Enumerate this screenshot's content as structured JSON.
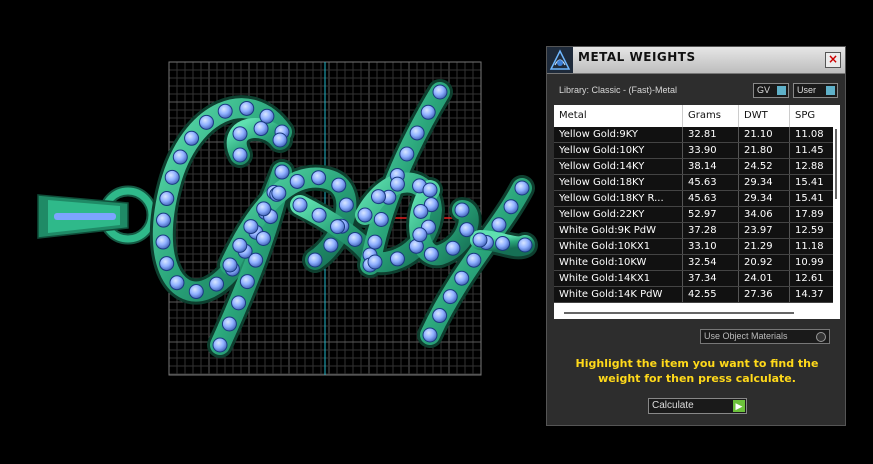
{
  "panel": {
    "title": "METAL WEIGHTS",
    "close_symbol": "×",
    "library_label": "Library: Classic - (Fast)-Metal",
    "toggles": {
      "gv": "GV",
      "user": "User"
    },
    "columns": [
      "Metal",
      "Grams",
      "DWT",
      "SPG"
    ],
    "rows": [
      [
        "Yellow Gold:9KY",
        "32.81",
        "21.10",
        "11.08"
      ],
      [
        "Yellow Gold:10KY",
        "33.90",
        "21.80",
        "11.45"
      ],
      [
        "Yellow Gold:14KY",
        "38.14",
        "24.52",
        "12.88"
      ],
      [
        "Yellow Gold:18KY",
        "45.63",
        "29.34",
        "15.41"
      ],
      [
        "Yellow Gold:18KY R...",
        "45.63",
        "29.34",
        "15.41"
      ],
      [
        "Yellow Gold:22KY",
        "52.97",
        "34.06",
        "17.89"
      ],
      [
        "White Gold:9K PdW",
        "37.28",
        "23.97",
        "12.59"
      ],
      [
        "White Gold:10KX1",
        "33.10",
        "21.29",
        "11.18"
      ],
      [
        "White Gold:10KW",
        "32.54",
        "20.92",
        "10.99"
      ],
      [
        "White Gold:14KX1",
        "37.34",
        "24.01",
        "12.61"
      ],
      [
        "White Gold:14K PdW",
        "42.55",
        "27.36",
        "14.37"
      ]
    ],
    "use_object_materials": "Use Object Materials",
    "instruction": "Highlight the item you want to find the weight for then press calculate.",
    "calculate_label": "Calculate",
    "calculate_icon": "play-arrow-icon",
    "accent_color": "#ffd91a"
  },
  "viewport": {
    "model_color": "#2fb98a",
    "gem_color": "#8fb4ff",
    "grid_color": "#444444"
  }
}
